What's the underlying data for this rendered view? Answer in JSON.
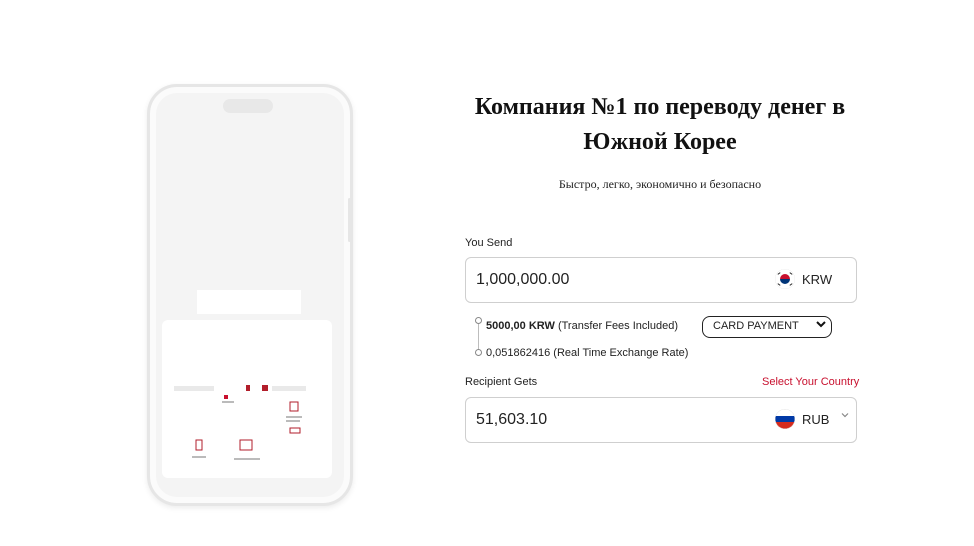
{
  "hero": {
    "title_line1": "Компания №1 по переводу денег в",
    "title_line2": "Южной Корее",
    "subtitle": "Быстро, легко, экономично и безопасно"
  },
  "send": {
    "label": "You Send",
    "amount": "1,000,000.00",
    "currency": "KRW",
    "flag_icon": "south-korea-flag-icon"
  },
  "fees": {
    "fee_amount": "5000,00 KRW",
    "fee_note": "(Transfer Fees Included)",
    "payment_method": "CARD PAYMENT",
    "rate_value": "0,051862416",
    "rate_note": "(Real Time Exchange Rate)"
  },
  "receive": {
    "label": "Recipient Gets",
    "select_country_link": "Select Your Country",
    "amount": "51,603.10",
    "currency": "RUB",
    "flag_icon": "russia-flag-icon"
  },
  "colors": {
    "accent_red": "#c8102e",
    "border": "#cfcfcf"
  }
}
